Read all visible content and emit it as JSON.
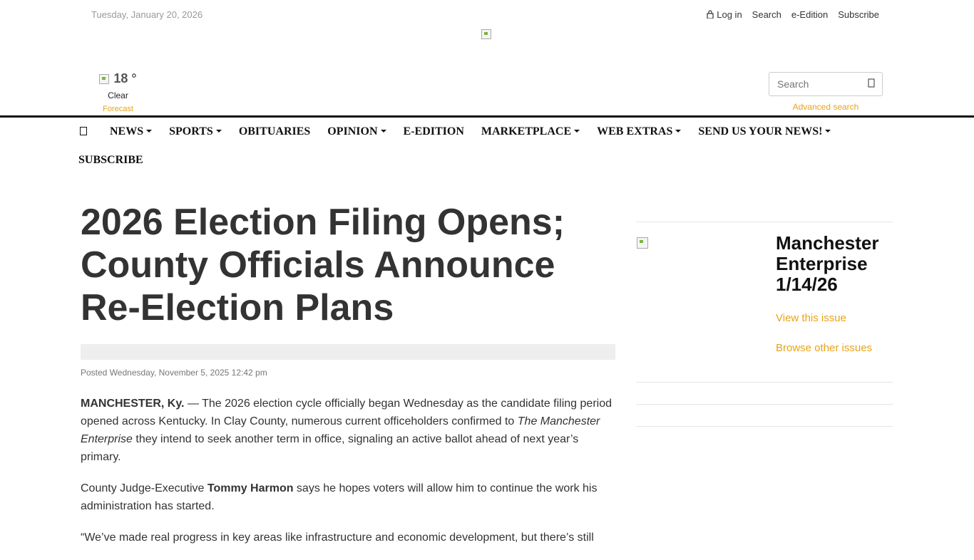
{
  "header": {
    "date": "Tuesday, January 20, 2026",
    "top_links": {
      "login": "Log in",
      "search": "Search",
      "eedition": "e-Edition",
      "subscribe": "Subscribe"
    }
  },
  "weather": {
    "temperature": "18 °",
    "condition": "Clear",
    "forecast_link": "Forecast"
  },
  "search": {
    "placeholder": "Search",
    "advanced_link": "Advanced search"
  },
  "nav": {
    "items": [
      "NEWS",
      "SPORTS",
      "OBITUARIES",
      "OPINION",
      "E-EDITION",
      "MARKETPLACE",
      "WEB EXTRAS",
      "SEND US YOUR NEWS!",
      "SUBSCRIBE"
    ]
  },
  "article": {
    "headline": "2026 Election Filing Opens; County Officials Announce Re-Election Plans",
    "posted": "Posted Wednesday, November 5, 2025 12:42 pm",
    "p1_dateline": "MANCHESTER, Ky.",
    "p1_text1": " — The 2026 election cycle officially began Wednesday as the candidate filing period opened across Kentucky. In Clay County, numerous current officeholders confirmed to ",
    "p1_italic": "The Manchester Enterprise",
    "p1_text2": " they intend to seek another term in office, signaling an active ballot ahead of next year’s primary.",
    "p2_text1": "County Judge-Executive ",
    "p2_bold": "Tommy Harmon",
    "p2_text2": " says he hopes voters will allow him to continue the work his administration has started.",
    "p3_text": "“We’ve made real progress in key areas like infrastructure and economic development, but there’s still"
  },
  "sidebar": {
    "issue_title": "Manchester Enterprise 1/14/26",
    "view_issue": "View this issue",
    "browse_issues": "Browse other issues"
  },
  "colors": {
    "accent": "#e8a317",
    "nav_line": "#111111"
  },
  "icons": {
    "login": "lock-icon",
    "search": "search-icon",
    "home": "home-icon"
  }
}
